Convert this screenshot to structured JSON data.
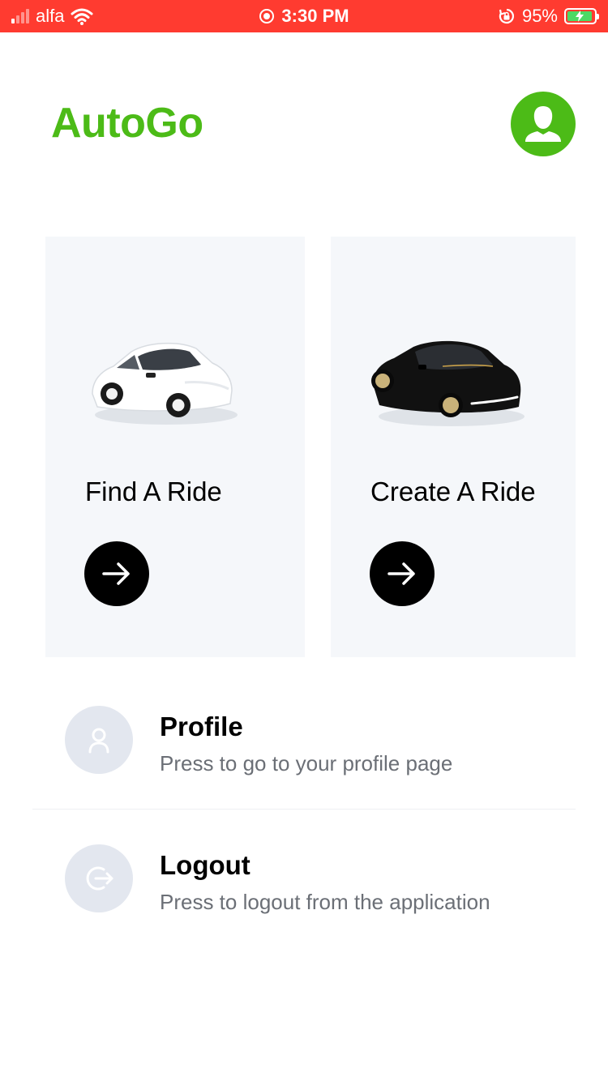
{
  "status_bar": {
    "carrier": "alfa",
    "time": "3:30 PM",
    "battery": "95%",
    "battery_level": 0.95,
    "background_color": "#ff3b30"
  },
  "header": {
    "title": "AutoGo",
    "brand_color": "#4cbb17",
    "avatar_icon": "user-icon"
  },
  "cards": [
    {
      "label": "Find A Ride",
      "car_icon": "white-car",
      "button_icon": "arrow-right-icon"
    },
    {
      "label": "Create A Ride",
      "car_icon": "black-car",
      "button_icon": "arrow-right-icon"
    }
  ],
  "menu": [
    {
      "title": "Profile",
      "subtitle": "Press to go to your profile page",
      "icon": "user-outline-icon"
    },
    {
      "title": "Logout",
      "subtitle": "Press to logout from the application",
      "icon": "logout-icon"
    }
  ]
}
